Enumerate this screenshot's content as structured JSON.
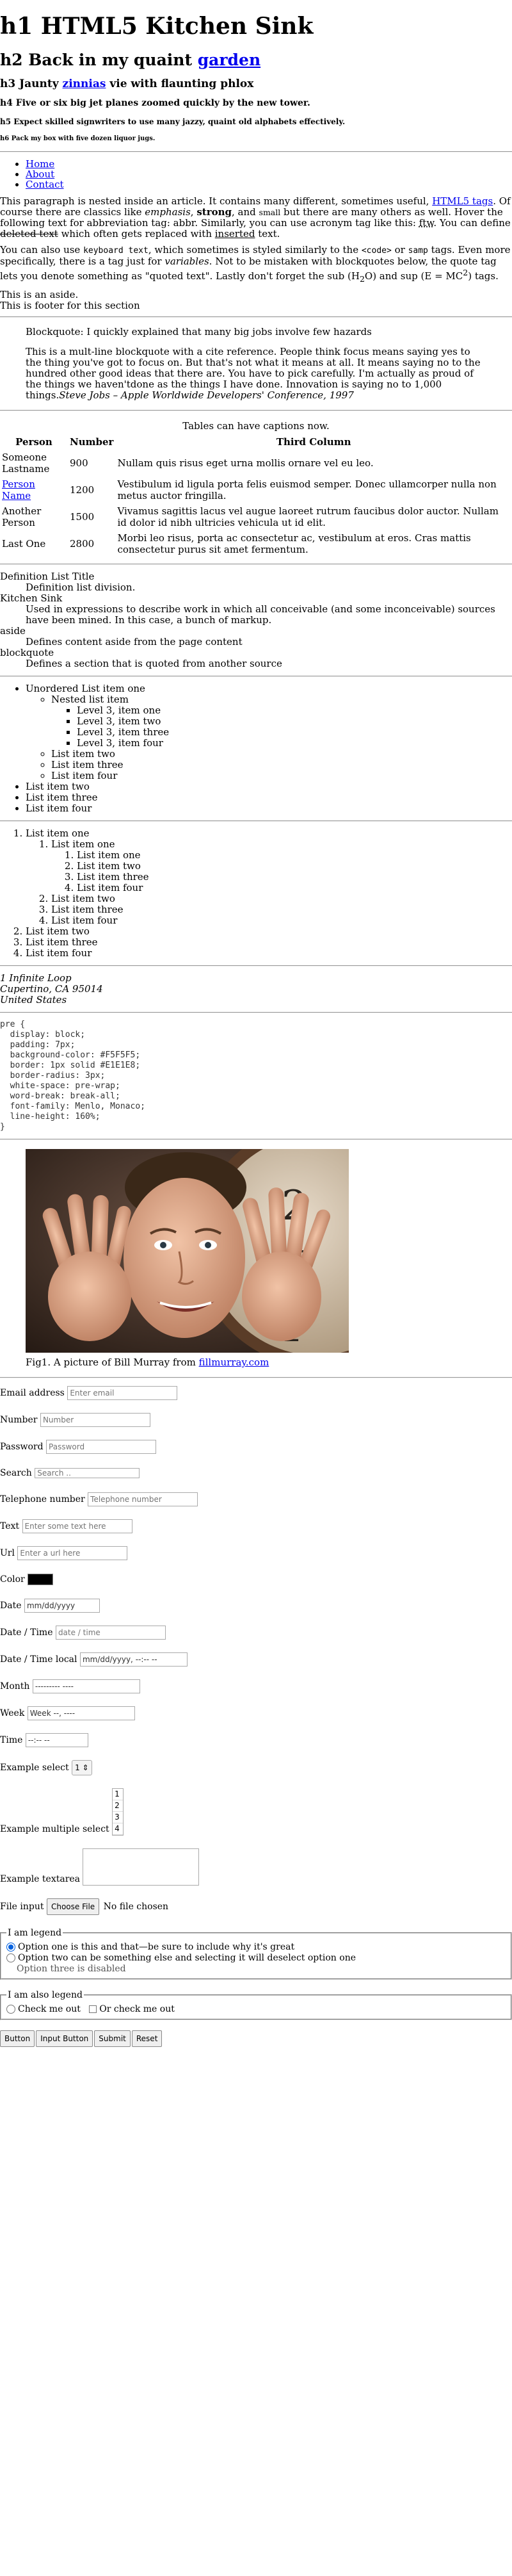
{
  "headings": {
    "h1": "h1 HTML5 Kitchen Sink",
    "h2_before": "h2 Back in my quaint ",
    "h2_link": "garden",
    "h3_before": "h3 Jaunty ",
    "h3_link": "zinnias",
    "h3_after": " vie with flaunting phlox",
    "h4": "h4 Five or six big jet planes zoomed quickly by the new tower.",
    "h5": "h5 Expect skilled signwriters to use many jazzy, quaint old alphabets effectively.",
    "h6": "h6 Pack my box with five dozen liquor jugs."
  },
  "nav": {
    "items": [
      "Home",
      "About",
      "Contact"
    ]
  },
  "paragraph1": {
    "t1": "This paragraph is nested inside an article. It contains many different, sometimes useful, ",
    "link": "HTML5 tags",
    "t2": ". Of course there are classics like ",
    "em": "emphasis",
    "t3": ", ",
    "strong": "strong",
    "t4": ", and ",
    "small": "small",
    "t5": " but there are many others as well. Hover the following text for abbreviation tag: ",
    "abbr": "abbr",
    "t6": ". Similarly, you can use acronym tag like this: ",
    "ftw": "ftw",
    "t7": ". You can define ",
    "del": "deleted text",
    "t8": " which often gets replaced with ",
    "ins": "inserted",
    "t9": " text."
  },
  "paragraph2": {
    "t1": "You can also use ",
    "kbd": "keyboard text",
    "t2": ", which sometimes is styled similarly to the ",
    "code": "<code>",
    "t3": " or ",
    "samp": "samp",
    "t4": " tags. Even more specifically, there is a tag just for ",
    "var": "variables",
    "t5": ". Not to be mistaken with blockquotes below, the quote tag lets you denote something as ",
    "q": "quoted text",
    "t6": ". Lastly don't forget the sub (H",
    "sub": "2",
    "t7": "O) and sup (E = MC",
    "sup": "2",
    "t8": ") tags."
  },
  "aside": {
    "text": "This is an aside.",
    "footer": "This is footer for this section"
  },
  "blockquote1": "Blockquote: I quickly explained that many big jobs involve few hazards",
  "blockquote2": {
    "text": "This is a mult-line blockquote with a cite reference. People think focus means saying yes to the thing you've got to focus on. But that's not what it means at all. It means saying no to the hundred other good ideas that there are. You have to pick carefully. I'm actually as proud of the things we haven'tdone as the things I have done. Innovation is saying no to 1,000 things.",
    "cite": "Steve Jobs – Apple Worldwide Developers' Conference, 1997"
  },
  "table": {
    "caption": "Tables can have captions now.",
    "headers": [
      "Person",
      "Number",
      "Third Column"
    ],
    "rows": [
      {
        "person": "Someone Lastname",
        "number": "900",
        "text": "Nullam quis risus eget urna mollis ornare vel eu leo.",
        "link": false
      },
      {
        "person": "Person Name",
        "number": "1200",
        "text": "Vestibulum id ligula porta felis euismod semper. Donec ullamcorper nulla non metus auctor fringilla.",
        "link": true
      },
      {
        "person": "Another Person",
        "number": "1500",
        "text": "Vivamus sagittis lacus vel augue laoreet rutrum faucibus dolor auctor. Nullam id dolor id nibh ultricies vehicula ut id elit.",
        "link": false
      },
      {
        "person": "Last One",
        "number": "2800",
        "text": "Morbi leo risus, porta ac consectetur ac, vestibulum at eros. Cras mattis consectetur purus sit amet fermentum.",
        "link": false
      }
    ]
  },
  "definitions": [
    {
      "term": "Definition List Title",
      "desc": "Definition list division."
    },
    {
      "term": "Kitchen Sink",
      "desc": "Used in expressions to describe work in which all conceivable (and some inconceivable) sources have been mined. In this case, a bunch of markup."
    },
    {
      "term": "aside",
      "desc": "Defines content aside from the page content"
    },
    {
      "term": "blockquote",
      "desc": "Defines a section that is quoted from another source"
    }
  ],
  "ulist": {
    "item1": "Unordered List item one",
    "nested": "Nested list item",
    "level3": [
      "Level 3, item one",
      "Level 3, item two",
      "Level 3, item three",
      "Level 3, item four"
    ],
    "level2_rest": [
      "List item two",
      "List item three",
      "List item four"
    ],
    "level1_rest": [
      "List item two",
      "List item three",
      "List item four"
    ]
  },
  "olist": {
    "item1": "List item one",
    "level2_first": "List item one",
    "level3": [
      "List item one",
      "List item two",
      "List item three",
      "List item four"
    ],
    "level2_rest": [
      "List item two",
      "List item three",
      "List item four"
    ],
    "level1_rest": [
      "List item two",
      "List item three",
      "List item four"
    ]
  },
  "address": [
    "1 Infinite Loop",
    "Cupertino, CA 95014",
    "United States"
  ],
  "pre": "pre {\n  display: block;\n  padding: 7px;\n  background-color: #F5F5F5;\n  border: 1px solid #E1E1E8;\n  border-radius: 3px;\n  white-space: pre-wrap;\n  word-break: break-all;\n  font-family: Menlo, Monaco;\n  line-height: 160%;\n}",
  "figure": {
    "caption_before": "Fig1. A picture of Bill Murray from ",
    "caption_link": "fillmurray.com"
  },
  "form": {
    "email": {
      "label": "Email address",
      "placeholder": "Enter email"
    },
    "number": {
      "label": "Number",
      "placeholder": "Number"
    },
    "password": {
      "label": "Password",
      "placeholder": "Password"
    },
    "search": {
      "label": "Search",
      "placeholder": "Search .."
    },
    "tel": {
      "label": "Telephone number",
      "placeholder": "Telephone number"
    },
    "text": {
      "label": "Text",
      "placeholder": "Enter some text here"
    },
    "url": {
      "label": "Url",
      "placeholder": "Enter a url here"
    },
    "color": {
      "label": "Color",
      "value": "#000000"
    },
    "date": {
      "label": "Date",
      "placeholder": "mm/dd/yyyy"
    },
    "datetime": {
      "label": "Date / Time",
      "placeholder": "date / time"
    },
    "datetime_local": {
      "label": "Date / Time local",
      "placeholder": "mm/dd/yyyy, --:-- --"
    },
    "month": {
      "label": "Month",
      "placeholder": "--------- ----"
    },
    "week": {
      "label": "Week",
      "placeholder": "Week --, ----"
    },
    "time": {
      "label": "Time",
      "placeholder": "--:-- --"
    },
    "select": {
      "label": "Example select",
      "value": "1"
    },
    "multiselect": {
      "label": "Example multiple select",
      "options": [
        "1",
        "2",
        "3",
        "4"
      ]
    },
    "textarea": {
      "label": "Example textarea"
    },
    "file": {
      "label": "File input",
      "button": "Choose File",
      "status": "No file chosen"
    },
    "radios": {
      "legend": "I am legend",
      "options": [
        {
          "label": "Option one is this and that—be sure to include why it's great",
          "checked": true
        },
        {
          "label": "Option two can be something else and selecting it will deselect option one",
          "checked": false
        },
        {
          "label": "Option three is disabled",
          "checked": false,
          "disabled": true
        }
      ]
    },
    "checks": {
      "legend": "I am also legend",
      "options": [
        "Check me out",
        "Or check me out"
      ]
    },
    "buttons": [
      "Button",
      "Input Button",
      "Submit",
      "Reset"
    ]
  }
}
